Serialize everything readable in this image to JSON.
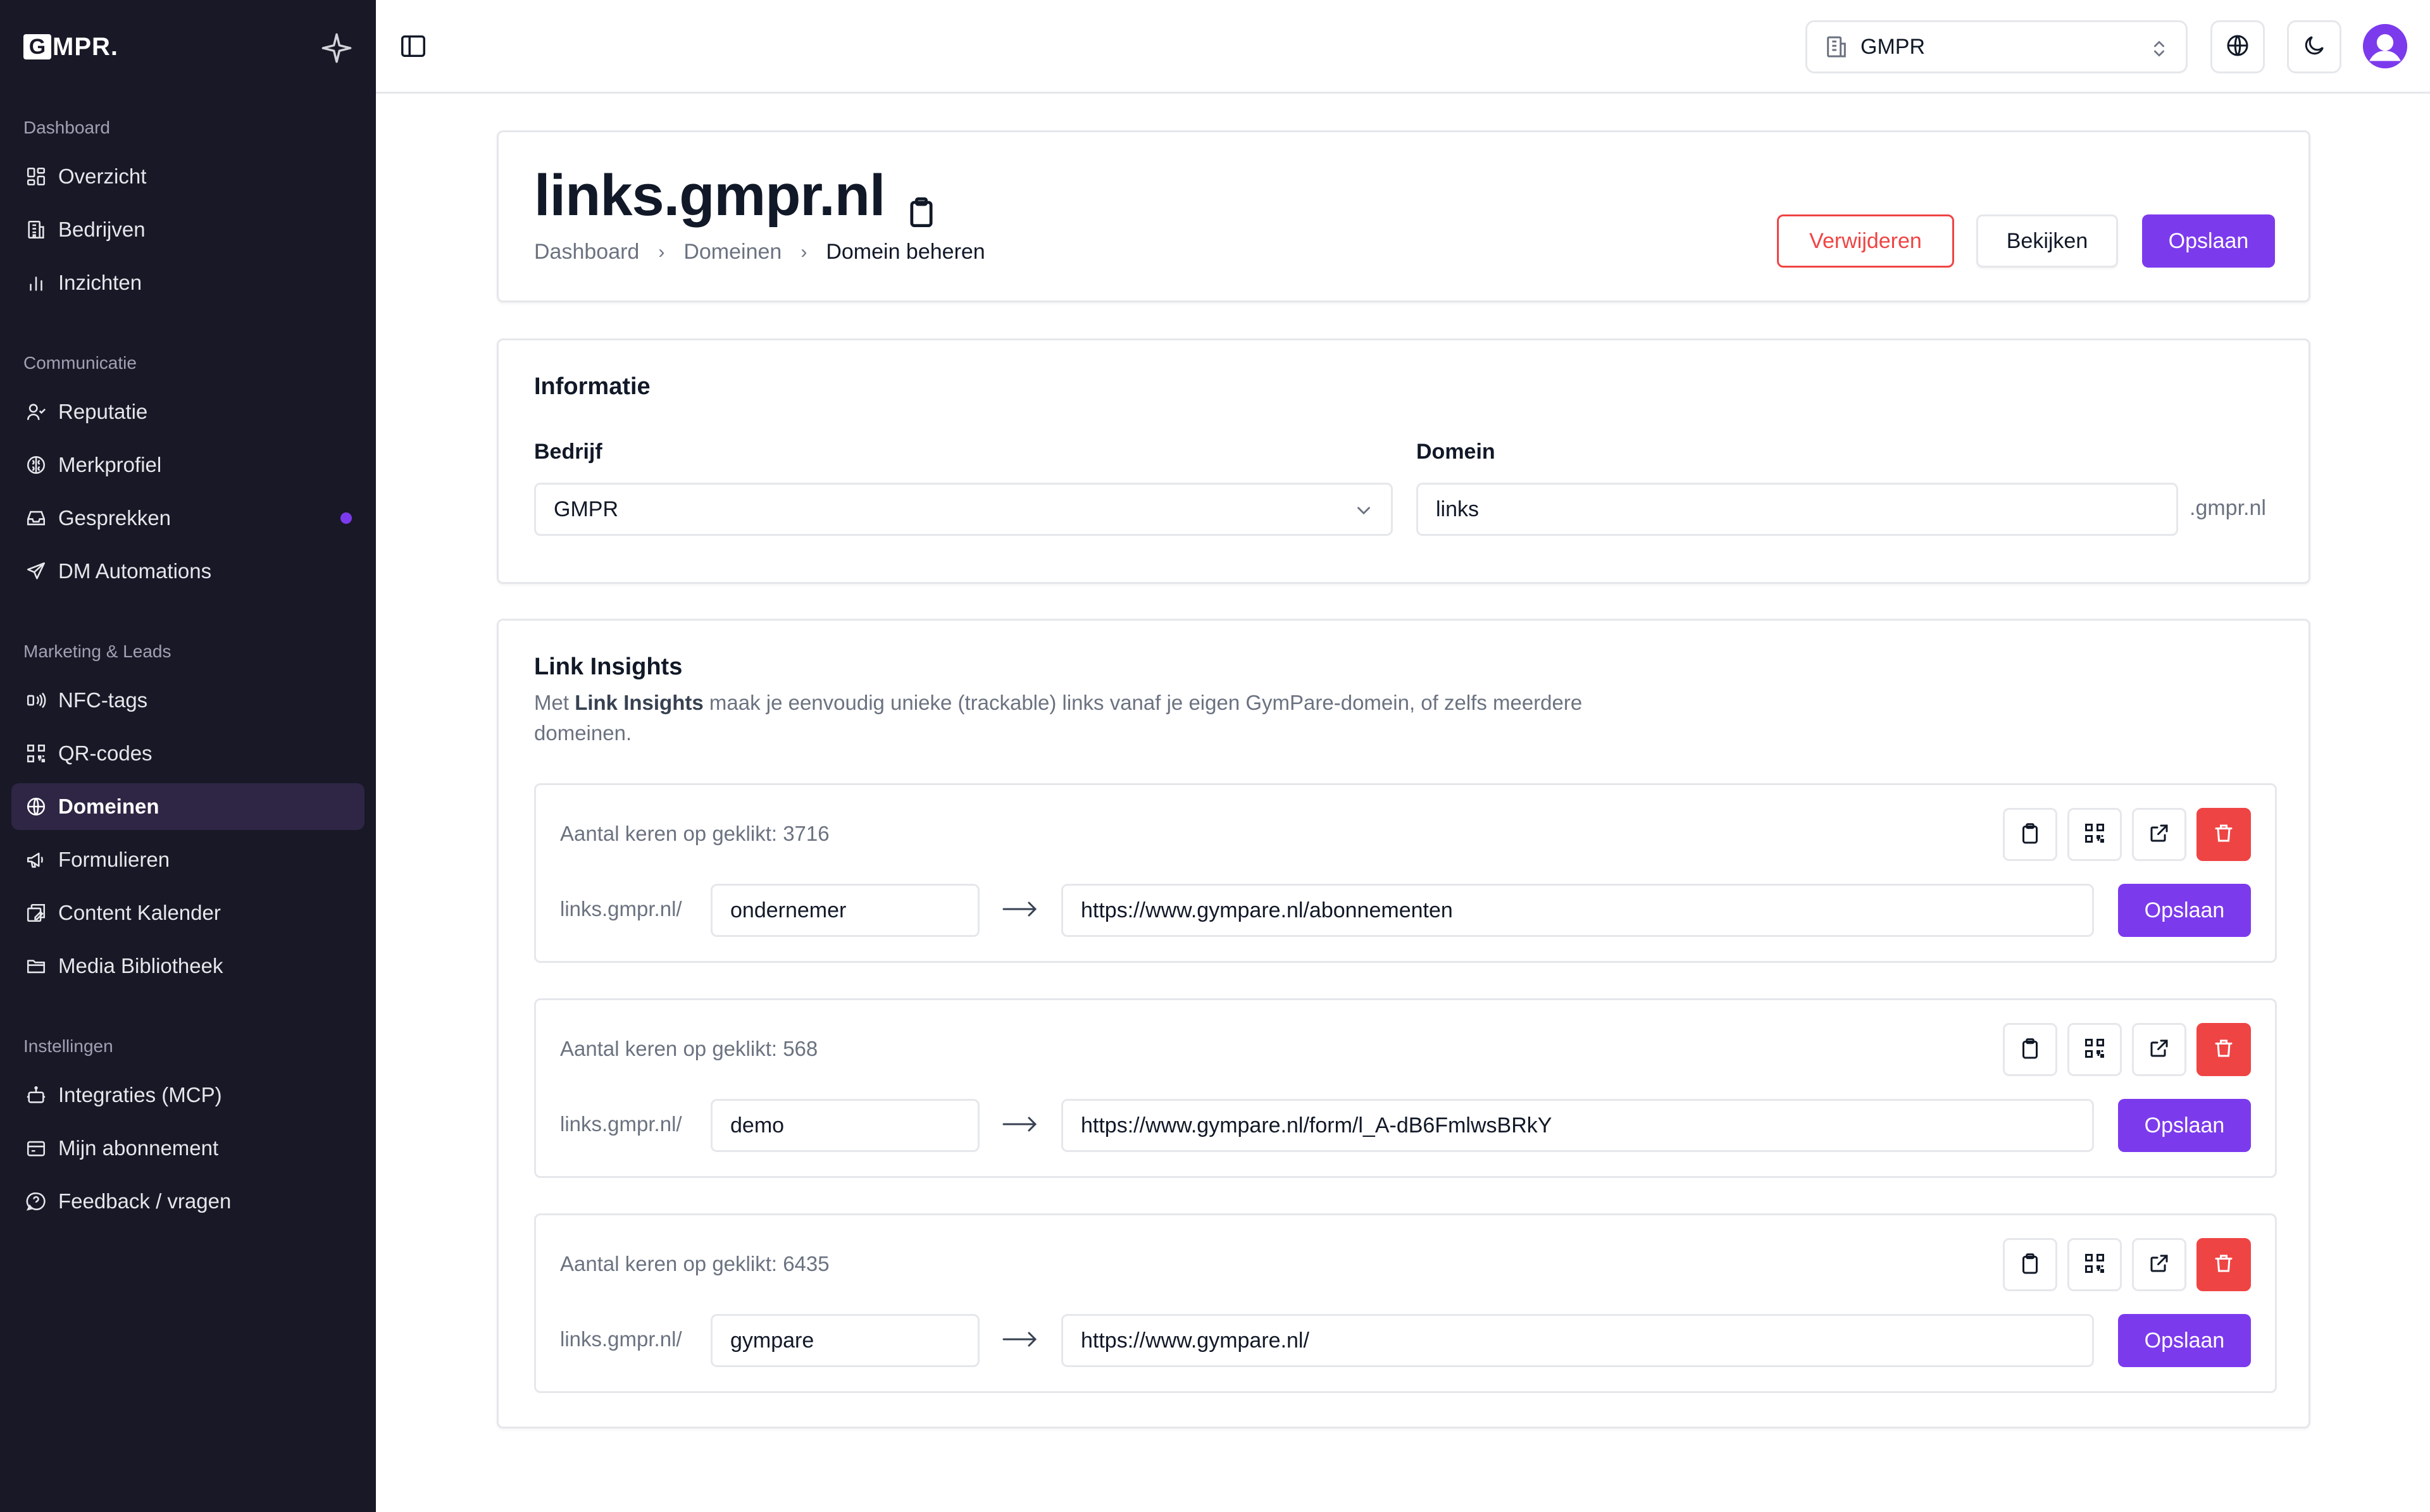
{
  "brand": {
    "logo_mark": "G",
    "logo_text": "MPR."
  },
  "sidebar": {
    "sections": [
      {
        "label": "Dashboard"
      },
      {
        "label": "Communicatie"
      },
      {
        "label": "Marketing & Leads"
      },
      {
        "label": "Instellingen"
      }
    ],
    "items": [
      {
        "label": "Overzicht",
        "icon": "layout-grid-icon"
      },
      {
        "label": "Bedrijven",
        "icon": "building-icon"
      },
      {
        "label": "Inzichten",
        "icon": "bar-chart-icon"
      },
      {
        "label": "Reputatie",
        "icon": "users-icon"
      },
      {
        "label": "Merkprofiel",
        "icon": "brain-icon"
      },
      {
        "label": "Gesprekken",
        "icon": "inbox-icon",
        "badge": "unread-dot"
      },
      {
        "label": "DM Automations",
        "icon": "send-icon"
      },
      {
        "label": "NFC-tags",
        "icon": "nfc-icon"
      },
      {
        "label": "QR-codes",
        "icon": "qr-code-icon"
      },
      {
        "label": "Domeinen",
        "icon": "globe-icon",
        "active": true
      },
      {
        "label": "Formulieren",
        "icon": "megaphone-icon"
      },
      {
        "label": "Content Kalender",
        "icon": "calendar-edit-icon"
      },
      {
        "label": "Media Bibliotheek",
        "icon": "folder-open-icon"
      },
      {
        "label": "Integraties (MCP)",
        "icon": "bot-icon"
      },
      {
        "label": "Mijn abonnement",
        "icon": "wallet-icon"
      },
      {
        "label": "Feedback / vragen",
        "icon": "help-circle-icon"
      }
    ]
  },
  "topbar": {
    "org_name": "GMPR"
  },
  "header": {
    "title": "links.gmpr.nl",
    "breadcrumb": [
      "Dashboard",
      "Domeinen",
      "Domein beheren"
    ],
    "buttons": {
      "delete": "Verwijderen",
      "view": "Bekijken",
      "save": "Opslaan"
    }
  },
  "info": {
    "title": "Informatie",
    "company_label": "Bedrijf",
    "company_value": "GMPR",
    "domain_label": "Domein",
    "domain_value": "links",
    "domain_suffix": ".gmpr.nl"
  },
  "insights": {
    "title": "Link Insights",
    "desc_prefix": "Met ",
    "desc_bold": "Link Insights",
    "desc_rest": " maak je eenvoudig unieke (trackable) links vanaf je eigen GymPare-domein, of zelfs meerdere domeinen.",
    "links": [
      {
        "count_text": "Aantal keren op geklikt: 3716",
        "prefix": "links.gmpr.nl/",
        "slug": "ondernemer",
        "target": "https://www.gympare.nl/abonnementen",
        "save": "Opslaan"
      },
      {
        "count_text": "Aantal keren op geklikt: 568",
        "prefix": "links.gmpr.nl/",
        "slug": "demo",
        "target": "https://www.gympare.nl/form/l_A-dB6FmlwsBRkY",
        "save": "Opslaan"
      },
      {
        "count_text": "Aantal keren op geklikt: 6435",
        "prefix": "links.gmpr.nl/",
        "slug": "gympare",
        "target": "https://www.gympare.nl/",
        "save": "Opslaan"
      }
    ]
  },
  "colors": {
    "accent": "#7c3aed",
    "danger": "#ef4444",
    "sidebar_bg": "#181826",
    "sidebar_active": "#2f2645"
  }
}
